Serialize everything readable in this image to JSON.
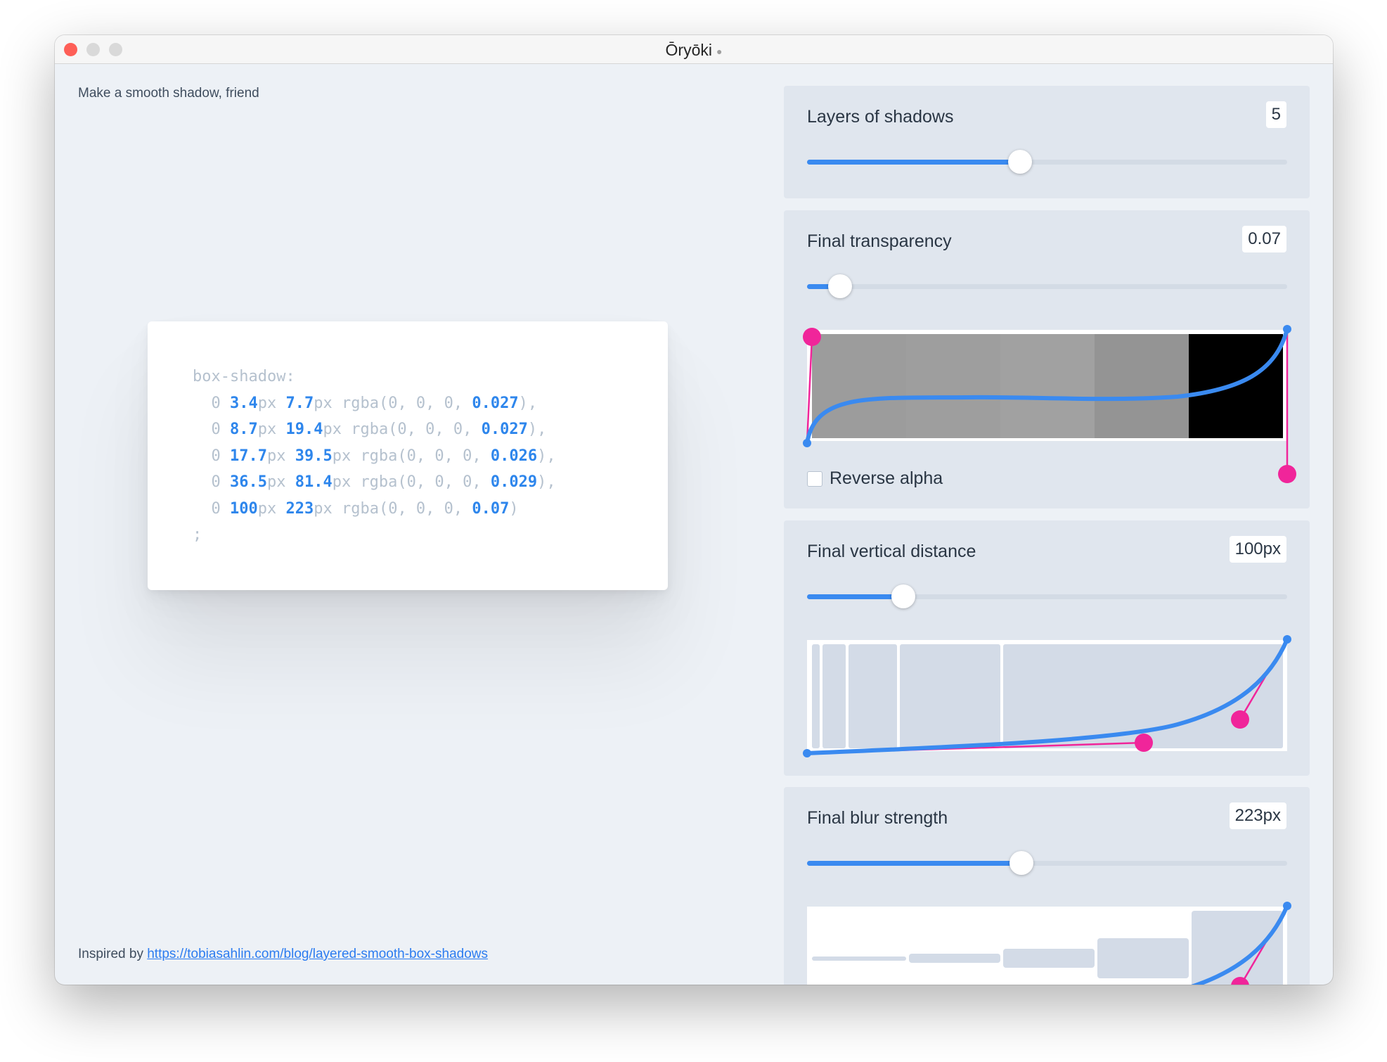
{
  "window": {
    "title": "Ōryōki"
  },
  "tagline": "Make a smooth shadow, friend",
  "inspired": {
    "prefix": "Inspired by",
    "link_text": "https://tobiasahlin.com/blog/layered-smooth-box-shadows"
  },
  "code": {
    "property": "box-shadow:",
    "layers": [
      {
        "y": "3.4",
        "blur": "7.7",
        "alpha": "0.027",
        "end": "),"
      },
      {
        "y": "8.7",
        "blur": "19.4",
        "alpha": "0.027",
        "end": "),"
      },
      {
        "y": "17.7",
        "blur": "39.5",
        "alpha": "0.026",
        "end": "),"
      },
      {
        "y": "36.5",
        "blur": "81.4",
        "alpha": "0.029",
        "end": "),"
      },
      {
        "y": "100",
        "blur": "223",
        "alpha": "0.07",
        "end": ")"
      }
    ],
    "terminator": ";"
  },
  "controls": {
    "layers": {
      "label": "Layers of shadows",
      "value": "5",
      "level": 0.444
    },
    "transparency": {
      "label": "Final transparency",
      "value": "0.07",
      "level": 0.069,
      "reverse_label": "Reverse alpha",
      "reverse_checked": false,
      "swatch_grays": [
        "#9c9c9c",
        "#9e9e9e",
        "#a1a1a1",
        "#949494",
        "#000000"
      ]
    },
    "vertical": {
      "label": "Final vertical distance",
      "value": "100px",
      "level": 0.2
    },
    "blur": {
      "label": "Final blur strength",
      "value": "223px",
      "level": 0.446
    }
  },
  "colors": {
    "accent": "#3a8af0",
    "handle": "#f0259a",
    "code_number": "#2e86ec",
    "code_muted": "#b5c1ce",
    "panel_bg": "#e0e6ee"
  }
}
